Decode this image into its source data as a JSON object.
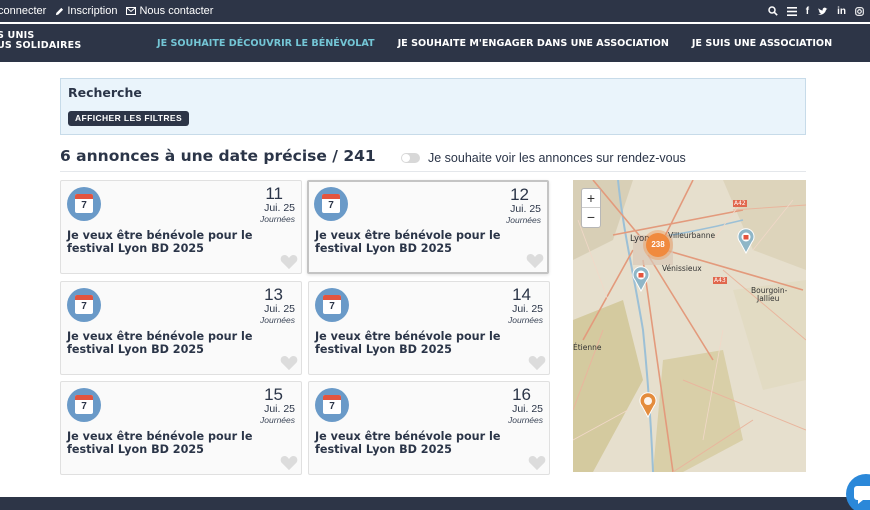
{
  "topbar": {
    "links": [
      {
        "label": "connecter",
        "icon": ""
      },
      {
        "label": "Inscription",
        "icon": "pencil-icon"
      },
      {
        "label": "Nous contacter",
        "icon": "envelope-icon"
      }
    ],
    "social_icons": [
      "search-icon",
      "menu-icon",
      "facebook-icon",
      "twitter-icon",
      "linkedin-icon",
      "instagram-icon"
    ]
  },
  "header": {
    "logo_line1": "S UNIS",
    "logo_line2": "US SOLIDAIRES",
    "nav": [
      {
        "label": "JE SOUHAITE DÉCOUVRIR LE BÉNÉVOLAT",
        "active": true
      },
      {
        "label": "JE SOUHAITE M'ENGAGER DANS UNE ASSOCIATION",
        "active": false
      },
      {
        "label": "JE SUIS UNE ASSOCIATION",
        "active": false
      }
    ]
  },
  "search": {
    "title": "Recherche",
    "filter_button": "AFFICHER LES FILTRES"
  },
  "results": {
    "count_label": "6 annonces à une date précise / 241",
    "toggle_label": "Je souhaite voir les annonces sur rendez-vous"
  },
  "cards": [
    {
      "icon_num": "7",
      "day": "11",
      "month": "Jui. 25",
      "duration": "Journées",
      "title": "Je veux être bénévole pour le festival Lyon BD 2025"
    },
    {
      "icon_num": "7",
      "day": "12",
      "month": "Jui. 25",
      "duration": "Journées",
      "title": "Je veux être bénévole pour le festival Lyon BD 2025"
    },
    {
      "icon_num": "7",
      "day": "13",
      "month": "Jui. 25",
      "duration": "Journées",
      "title": "Je veux être bénévole pour le festival Lyon BD 2025"
    },
    {
      "icon_num": "7",
      "day": "14",
      "month": "Jui. 25",
      "duration": "Journées",
      "title": "Je veux être bénévole pour le festival Lyon BD 2025"
    },
    {
      "icon_num": "7",
      "day": "15",
      "month": "Jui. 25",
      "duration": "Journées",
      "title": "Je veux être bénévole pour le festival Lyon BD 2025"
    },
    {
      "icon_num": "7",
      "day": "16",
      "month": "Jui. 25",
      "duration": "Journées",
      "title": "Je veux être bénévole pour le festival Lyon BD 2025"
    }
  ],
  "map": {
    "zoom_in": "+",
    "zoom_out": "−",
    "cluster_count": "238",
    "labels": {
      "lyon": "Lyon",
      "villeurbanne": "Villeurbanne",
      "venissieux": "Vénissieux",
      "bourgoin": "Bourgoin-",
      "jallieu": "Jallieu",
      "etienne": "Étienne",
      "a42": "A42",
      "a43": "A43"
    }
  },
  "colors": {
    "navy": "#2d3547",
    "accent_teal": "#74c6d6",
    "search_bg": "#eaf4fb",
    "cluster_orange": "#f08a3e",
    "chat_blue": "#2b88d9"
  }
}
